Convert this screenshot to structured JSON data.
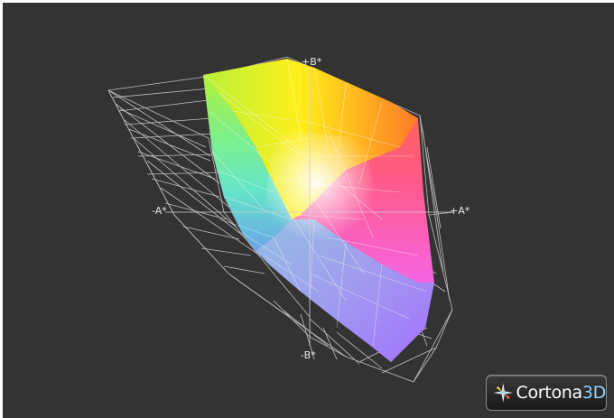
{
  "viewport": {
    "axes": {
      "plus_b": "+B*",
      "minus_b": "-B*",
      "plus_a": "+A*",
      "minus_a": "-A*"
    }
  },
  "brand": {
    "name_main": "Cortona",
    "name_accent": "3D",
    "icon": "cortona-star-icon"
  }
}
